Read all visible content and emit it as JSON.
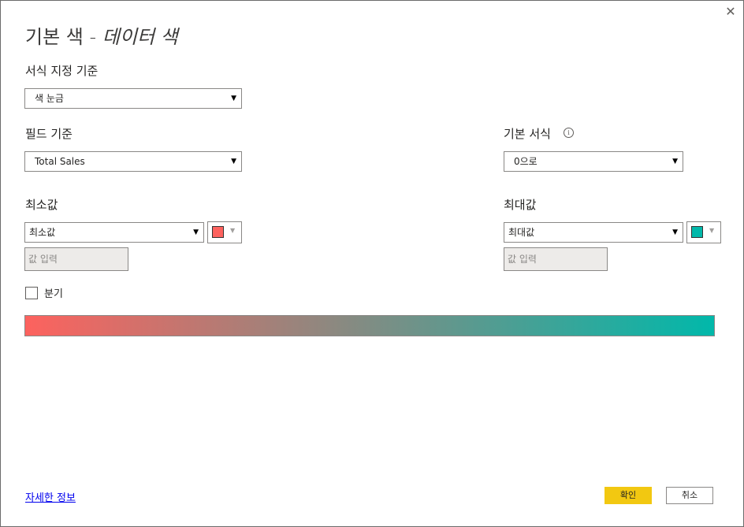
{
  "dialog": {
    "title_main": "기본 색 - ",
    "title_sub": "데이터 색",
    "close_glyph": "✕"
  },
  "format_by": {
    "label": "서식 지정 기준",
    "value": "색 눈금"
  },
  "field": {
    "label": "필드 기준",
    "value": "Total Sales"
  },
  "default_format": {
    "label": "기본 서식",
    "info_glyph": "i",
    "value": "0으로"
  },
  "minimum": {
    "label": "최소값",
    "select_value": "최소값",
    "color": "#fd625e",
    "input_placeholder": "값 입력"
  },
  "maximum": {
    "label": "최대값",
    "select_value": "최대값",
    "color": "#01b8aa",
    "input_placeholder": "값 입력"
  },
  "diverging": {
    "label": "분기",
    "checked": false
  },
  "gradient": {
    "start_color": "#fd625e",
    "end_color": "#01b8aa"
  },
  "footer": {
    "learn_more": "자세한 정보",
    "ok": "확인",
    "cancel": "취소"
  },
  "icons": {
    "dropdown_arrow": "▼",
    "color_caret": "▼"
  }
}
